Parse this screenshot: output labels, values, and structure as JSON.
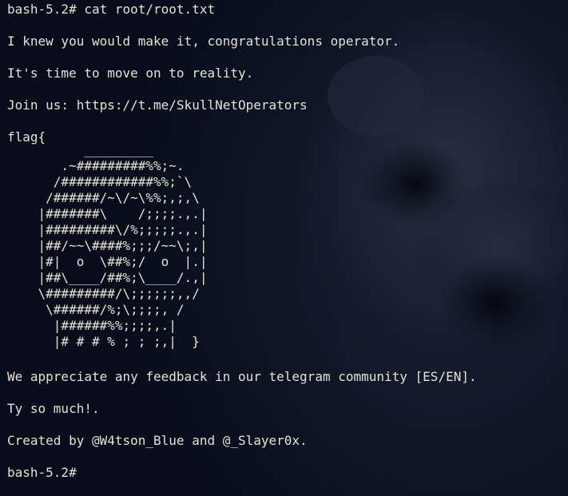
{
  "terminal": {
    "prompt_command": "bash-5.2# cat root/root.txt",
    "line_knew": "I knew you would make it, congratulations operator.",
    "line_time": "It's time to move on to reality.",
    "line_join": "Join us: https://t.me/SkullNetOperators",
    "line_flag_open": "flag{",
    "ascii_art": "          _________\n       .~#########%%;~.\n      /############%%;`\\\n     /######/~\\/~\\%%;,;,\\\n    |#######\\    /;;;;.,.|\n    |#########\\/%;;;;;.,.|\n    |##/~~\\####%;;;/~~\\;,|\n    |#|  o  \\##%;/  o  |.|\n    |##\\____/##%;\\____/.,|\n    \\#########/\\;;;;;;,,/\n     \\######/%;\\;;;;, /\n      |######%%;;;;,.|\n      |# # # % ; ; ;,|  }",
    "line_feedback": "We appreciate any feedback in our telegram community [ES/EN].",
    "line_thanks": "Ty so much!.",
    "line_created": "Created by @W4tson_Blue and @_Slayer0x.",
    "prompt_final": "bash-5.2#",
    "colors": {
      "background": "#0a1120",
      "text": "#e6e1d3"
    }
  }
}
